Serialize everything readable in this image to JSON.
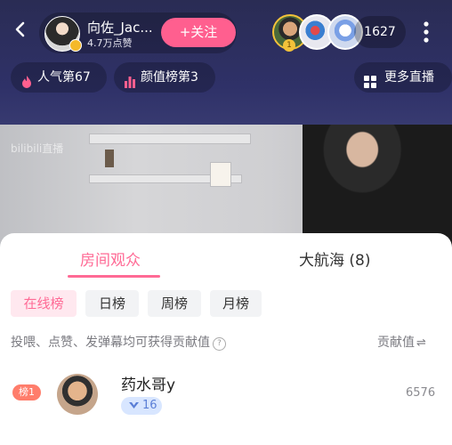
{
  "header": {
    "host_name": "向佐_Jac...",
    "host_likes": "4.7万点赞",
    "follow_label": "+关注",
    "viewer_rank": "1",
    "viewer_count": "1627"
  },
  "chips": {
    "popularity": "人气第67",
    "looks": "颜值榜第3",
    "more": "更多直播"
  },
  "video": {
    "watermark": "bilibili直播"
  },
  "sheet": {
    "tabs": [
      {
        "label": "房间观众",
        "active": true
      },
      {
        "label": "大航海 (8)",
        "active": false
      }
    ],
    "filters": [
      "在线榜",
      "日榜",
      "周榜",
      "月榜"
    ],
    "hint": "投喂、点赞、发弹幕均可获得贡献值",
    "hint_help": "?",
    "contribution_label": "贡献值",
    "sort_icon": "⇌",
    "rows": [
      {
        "rank": "榜1",
        "name": "药水哥y",
        "level": "16",
        "score": "6576"
      }
    ]
  },
  "colors": {
    "accent": "#ff6a95",
    "follow": "#ff5f8f",
    "rank_badge": "#ff7d6b",
    "level_bg": "#d8e6ff"
  },
  "icons": [
    "back-arrow-icon",
    "more-vertical-icon",
    "flame-icon",
    "bar-chart-icon",
    "grid-icon",
    "chevron-right-icon",
    "help-circle-icon",
    "sort-icon",
    "level-icon"
  ]
}
